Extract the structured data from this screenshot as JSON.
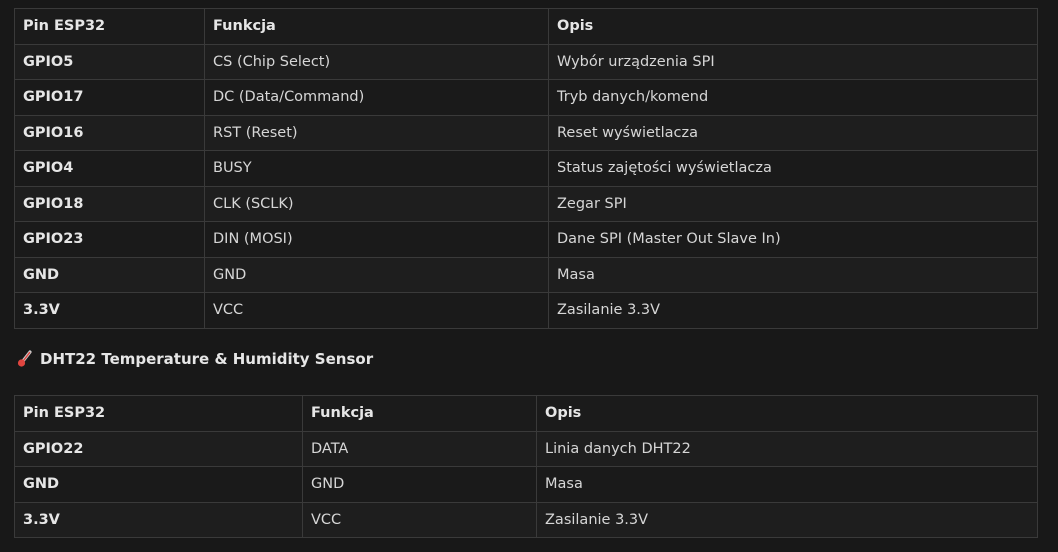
{
  "display_table": {
    "headers": [
      "Pin ESP32",
      "Funkcja",
      "Opis"
    ],
    "rows": [
      [
        "GPIO5",
        "CS (Chip Select)",
        "Wybór urządzenia SPI"
      ],
      [
        "GPIO17",
        "DC (Data/Command)",
        "Tryb danych/komend"
      ],
      [
        "GPIO16",
        "RST (Reset)",
        "Reset wyświetlacza"
      ],
      [
        "GPIO4",
        "BUSY",
        "Status zajętości wyświetlacza"
      ],
      [
        "GPIO18",
        "CLK (SCLK)",
        "Zegar SPI"
      ],
      [
        "GPIO23",
        "DIN (MOSI)",
        "Dane SPI (Master Out Slave In)"
      ],
      [
        "GND",
        "GND",
        "Masa"
      ],
      [
        "3.3V",
        "VCC",
        "Zasilanie 3.3V"
      ]
    ]
  },
  "dht_section": {
    "heading": "DHT22 Temperature & Humidity Sensor",
    "icon": "thermometer-icon"
  },
  "dht_table": {
    "headers": [
      "Pin ESP32",
      "Funkcja",
      "Opis"
    ],
    "rows": [
      [
        "GPIO22",
        "DATA",
        "Linia danych DHT22"
      ],
      [
        "GND",
        "GND",
        "Masa"
      ],
      [
        "3.3V",
        "VCC",
        "Zasilanie 3.3V"
      ]
    ]
  }
}
